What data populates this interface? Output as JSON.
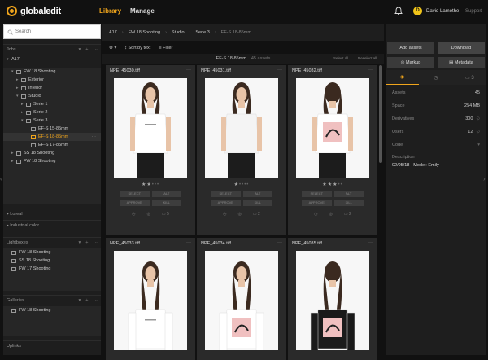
{
  "header": {
    "logo_text": "globaledit",
    "nav": [
      "Library",
      "Manage"
    ],
    "avatar_initial": "D",
    "user": "David Lamothe",
    "support": "Support"
  },
  "search": {
    "placeholder": "Search"
  },
  "jobs": {
    "title": "Jobs",
    "root": "A17",
    "tree": [
      {
        "label": "FW 18 Shooting",
        "indent": 1,
        "expanded": true
      },
      {
        "label": "Exterior",
        "indent": 2
      },
      {
        "label": "Interior",
        "indent": 2
      },
      {
        "label": "Studio",
        "indent": 2,
        "expanded": true
      },
      {
        "label": "Serie 1",
        "indent": 3
      },
      {
        "label": "Serie 2",
        "indent": 3
      },
      {
        "label": "Serie 3",
        "indent": 3,
        "expanded": true
      },
      {
        "label": "EF-S 15-85mm",
        "indent": 4
      },
      {
        "label": "EF-S 18-85mm",
        "indent": 4,
        "selected": true
      },
      {
        "label": "EF-S 17-85mm",
        "indent": 4
      },
      {
        "label": "SS 18 Shooting",
        "indent": 1
      },
      {
        "label": "FW 18 Shooting",
        "indent": 1
      }
    ]
  },
  "extra_sections": [
    "Loreal",
    "Industrial color"
  ],
  "lightboxes": {
    "title": "Lightboxes",
    "items": [
      "FW 18 Shooting",
      "SS 18 Shooting",
      "FW 17 Shooting"
    ]
  },
  "galleries": {
    "title": "Galleries",
    "items": [
      "FW 18 Shooting"
    ]
  },
  "uplinks": {
    "title": "Uplinks"
  },
  "breadcrumb": [
    "A17",
    "FW 18 Shooting",
    "Studio",
    "Serie 3",
    "EF-S 18-85mm"
  ],
  "toolbar": {
    "sort": "Sort by text",
    "filter": "Filter"
  },
  "folder": {
    "name": "EF-S 18-85mm",
    "count": "45 assets",
    "select_all": "Select all",
    "deselect_all": "Deselect all"
  },
  "card_buttons": [
    "SELECT",
    "ALT",
    "APPROVE",
    "KILL"
  ],
  "cards": [
    {
      "file": "NPE_45030.tiff",
      "stars": 2,
      "comments": "5"
    },
    {
      "file": "NPE_45031.tiff",
      "stars": 1,
      "comments": "2"
    },
    {
      "file": "NPE_45032.tiff",
      "stars": 3,
      "comments": "2"
    },
    {
      "file": "NPE_45033.tiff",
      "stars": 0,
      "comments": ""
    },
    {
      "file": "NPE_45034.tiff",
      "stars": 0,
      "comments": ""
    },
    {
      "file": "NPE_45035.tiff",
      "stars": 0,
      "comments": ""
    }
  ],
  "right": {
    "add_assets": "Add assets",
    "download": "Download",
    "markup": "Markup",
    "metadata": "Metadata",
    "tab3_count": "3",
    "props": [
      {
        "label": "Assets",
        "value": "45"
      },
      {
        "label": "Space",
        "value": "254 MB"
      },
      {
        "label": "Derivatives",
        "value": "300"
      },
      {
        "label": "Users",
        "value": "12"
      },
      {
        "label": "Code",
        "value": ""
      }
    ],
    "desc_label": "Description",
    "desc_value": "02/05/18 - Model: Emily"
  }
}
